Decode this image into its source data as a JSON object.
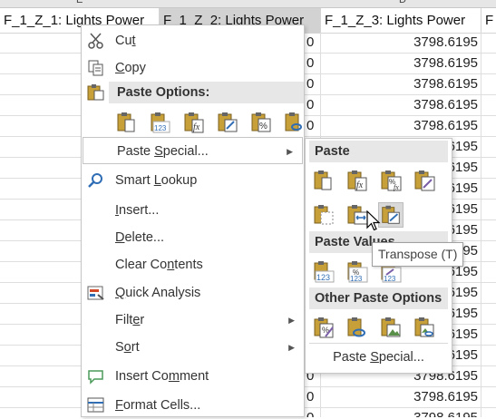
{
  "sheet": {
    "column_letters": [
      "E",
      "D"
    ],
    "headers": [
      "F_1_Z_1: Lights Power",
      "F_1_Z_2: Lights Power",
      "F_1_Z_3: Lights Power",
      "F"
    ],
    "rows": [
      {
        "c2": "0",
        "c3": "3798.6195"
      },
      {
        "c2": "0",
        "c3": "3798.6195"
      },
      {
        "c2": "0",
        "c3": "3798.6195"
      },
      {
        "c2": "0",
        "c3": "3798.6195"
      },
      {
        "c2": "0",
        "c3": "3798.6195"
      },
      {
        "c2": "0",
        "c3": "3798.6195"
      },
      {
        "c2": "0",
        "c3": "3798.6195"
      },
      {
        "c2": "0",
        "c3": "3798.6195"
      },
      {
        "c2": "0",
        "c3": "3798.6195"
      },
      {
        "c2": "0",
        "c3": "3798.6195"
      },
      {
        "c2": "0",
        "c3": "3798.6195"
      },
      {
        "c2": "0",
        "c3": "3798.6195"
      },
      {
        "c2": "0",
        "c3": "3798.6195"
      },
      {
        "c2": "0",
        "c3": "3798.6195"
      },
      {
        "c2": "0",
        "c3": "3798.6195"
      },
      {
        "c2": "0",
        "c3": "3798.6195"
      },
      {
        "c2": "0",
        "c3": "3798.6195"
      },
      {
        "c2": "0",
        "c3": "3798.6195"
      },
      {
        "c2": "0",
        "c3": "3798.6195"
      }
    ]
  },
  "context_menu": {
    "cut": {
      "pre": "Cu",
      "key": "t",
      "post": ""
    },
    "copy": {
      "pre": "",
      "key": "C",
      "post": "opy"
    },
    "paste_options": "Paste Options:",
    "paste_special": {
      "pre": "Paste ",
      "key": "S",
      "post": "pecial..."
    },
    "smart_lookup": {
      "pre": "Smart ",
      "key": "L",
      "post": "ookup"
    },
    "insert": {
      "pre": "",
      "key": "I",
      "post": "nsert..."
    },
    "delete": {
      "pre": "",
      "key": "D",
      "post": "elete..."
    },
    "clear_contents": {
      "pre": "Clear Co",
      "key": "n",
      "post": "tents"
    },
    "quick_analysis": {
      "pre": "",
      "key": "Q",
      "post": "uick Analysis"
    },
    "filter": {
      "pre": "Filt",
      "key": "e",
      "post": "r"
    },
    "sort": {
      "pre": "S",
      "key": "o",
      "post": "rt"
    },
    "insert_comment": {
      "pre": "Insert Co",
      "key": "m",
      "post": "ment"
    },
    "format_cells": {
      "pre": "",
      "key": "F",
      "post": "ormat Cells..."
    }
  },
  "paste_submenu": {
    "paste_header": "Paste",
    "paste_values_header": "Paste Values",
    "other_header": "Other Paste Options",
    "paste_special_link": {
      "pre": "Paste ",
      "key": "S",
      "post": "pecial..."
    },
    "tooltip": "Transpose (T)",
    "icon_123": "123"
  },
  "colors": {
    "accent_blue": "#2f6db5",
    "icon_gold": "#c7a03a",
    "selected_header": "#d2d2d2"
  }
}
